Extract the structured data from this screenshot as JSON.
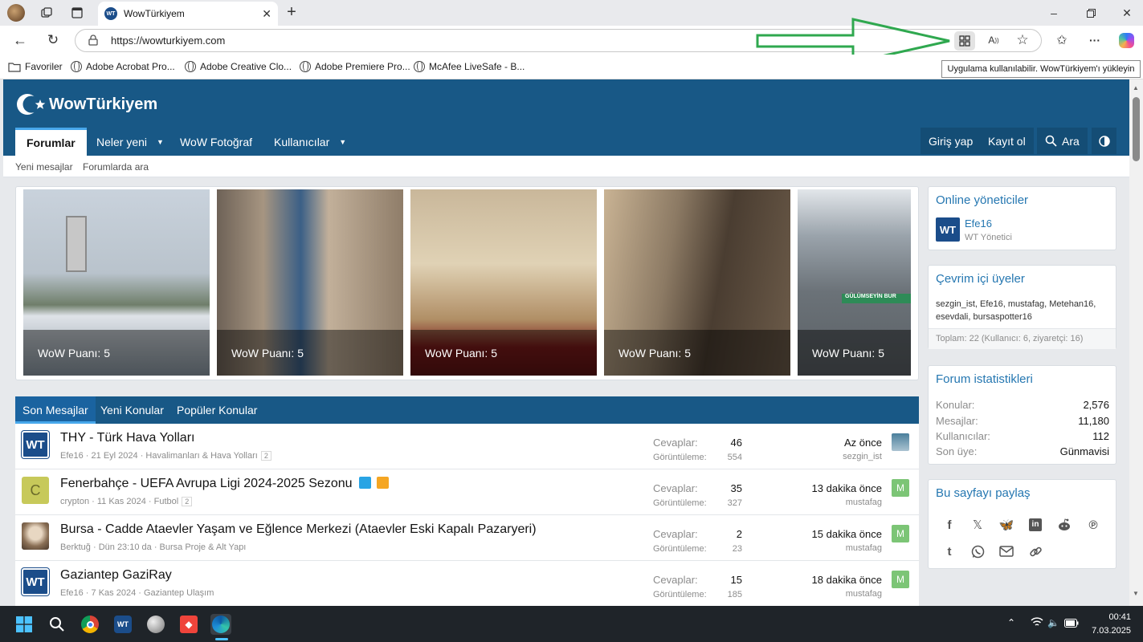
{
  "browser": {
    "tab_title": "WowTürkiyem",
    "tab_favicon": "WT",
    "url": "https://wowturkiyem.com",
    "tooltip": "Uygulama kullanılabilir. WowTürkiyem'ı yükleyin",
    "favorites": [
      "Favoriler",
      "Adobe Acrobat Pro...",
      "Adobe Creative Clo...",
      "Adobe Premiere Pro...",
      "McAfee LiveSafe - B..."
    ]
  },
  "site": {
    "logo": "WowTürkiyem",
    "nav": [
      "Forumlar",
      "Neler yeni",
      "WoW Fotoğraf",
      "Kullanıcılar"
    ],
    "nav_right": [
      "Giriş yap",
      "Kayıt ol",
      "Ara"
    ],
    "subnav": [
      "Yeni mesajlar",
      "Forumlarda ara"
    ]
  },
  "gallery": {
    "captions": [
      "WoW Puanı: 5",
      "WoW Puanı: 5",
      "WoW Puanı: 5",
      "WoW Puanı: 5",
      "WoW Puanı: 5"
    ],
    "overlay_text": "GÜLÜMSEYİN BUR"
  },
  "tabs": [
    "Son Mesajlar",
    "Yeni Konular",
    "Popüler Konular"
  ],
  "threads": [
    {
      "avatar": "WT",
      "title": "THY - Türk Hava Yolları",
      "author": "Efe16",
      "date": "21 Eyl 2024",
      "forum": "Havalimanları & Hava Yolları",
      "pages": "2",
      "replies_label": "Cevaplar:",
      "replies": "46",
      "views_label": "Görüntüleme:",
      "views": "554",
      "last_time": "Az önce",
      "last_user": "sezgin_ist"
    },
    {
      "avatar": "C",
      "title": "Fenerbahçe - UEFA Avrupa Ligi 2024-2025 Sezonu",
      "author": "crypton",
      "date": "11 Kas 2024",
      "forum": "Futbol",
      "pages": "2",
      "replies_label": "Cevaplar:",
      "replies": "35",
      "views_label": "Görüntüleme:",
      "views": "327",
      "last_time": "13 dakika önce",
      "last_user": "mustafag",
      "last_avatar": "M"
    },
    {
      "avatar": "",
      "title": "Bursa - Cadde Ataevler Yaşam ve Eğlence Merkezi (Ataevler Eski Kapalı Pazaryeri)",
      "author": "Berktuğ",
      "date": "Dün 23:10 da",
      "forum": "Bursa Proje & Alt Yapı",
      "replies_label": "Cevaplar:",
      "replies": "2",
      "views_label": "Görüntüleme:",
      "views": "23",
      "last_time": "15 dakika önce",
      "last_user": "mustafag",
      "last_avatar": "M"
    },
    {
      "avatar": "WT",
      "title": "Gaziantep GaziRay",
      "author": "Efe16",
      "date": "7 Kas 2024",
      "forum": "Gaziantep Ulaşım",
      "replies_label": "Cevaplar:",
      "replies": "15",
      "views_label": "Görüntüleme:",
      "views": "185",
      "last_time": "18 dakika önce",
      "last_user": "mustafag",
      "last_avatar": "M"
    }
  ],
  "sidebar": {
    "online_staff_title": "Online yöneticiler",
    "staff_name": "Efe16",
    "staff_role": "WT Yönetici",
    "staff_avatar": "WT",
    "online_title": "Çevrim içi üyeler",
    "online_users_line1": "sezgin_ist, Efe16, mustafag, Metehan16,",
    "online_users_line2": "esevdali, bursaspotter16",
    "online_total": "Toplam: 22 (Kullanıcı: 6, ziyaretçi: 16)",
    "stats_title": "Forum istatistikleri",
    "stats": [
      {
        "label": "Konular:",
        "value": "2,576"
      },
      {
        "label": "Mesajlar:",
        "value": "11,180"
      },
      {
        "label": "Kullanıcılar:",
        "value": "112"
      },
      {
        "label": "Son üye:",
        "value": "Günmavisi"
      }
    ],
    "share_title": "Bu sayfayı paylaş",
    "share_icons": [
      "facebook-icon",
      "x-icon",
      "bluesky-icon",
      "linkedin-icon",
      "reddit-icon",
      "pinterest-icon",
      "tumblr-icon",
      "whatsapp-icon",
      "email-icon",
      "link-icon"
    ]
  },
  "taskbar": {
    "time": "00:41",
    "date": "7.03.2025"
  },
  "colors": {
    "header": "#185886",
    "accent": "#47a7eb",
    "link": "#2577b1",
    "arrow": "#2fa84f"
  }
}
